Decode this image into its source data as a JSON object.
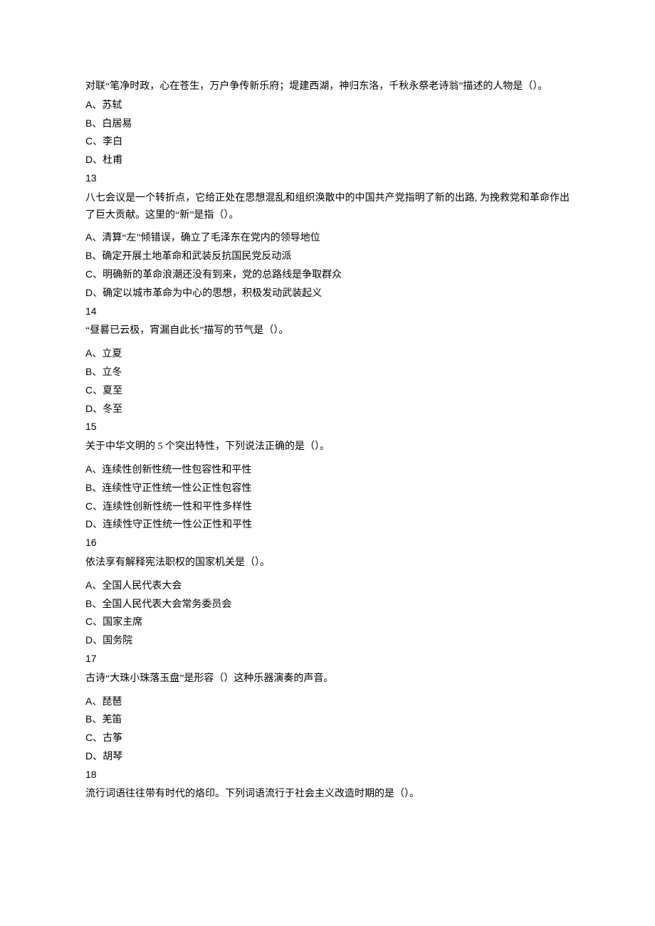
{
  "questions": [
    {
      "text": "对联“笔净时政，心在苍生，万户争传新乐府；堤建西湖，神归东洛，千秋永祭老诗翁”描述的人物是（）。",
      "options": [
        {
          "letter": "A",
          "text": "苏轼"
        },
        {
          "letter": "B",
          "text": "白居易"
        },
        {
          "letter": "C",
          "text": "李白"
        },
        {
          "letter": "D",
          "text": "杜甫"
        }
      ],
      "next_number": "13"
    },
    {
      "text": "八七会议是一个转折点，它给正处在思想混乱和组织涣散中的中国共产党指明了新的出路, 为挽救党和革命作出了巨大贡献。这里的“新”是指（）。",
      "options": [
        {
          "letter": "A",
          "text": "清算“左”倾错误，确立了毛泽东在党内的领导地位"
        },
        {
          "letter": "B",
          "text": "确定开展土地革命和武装反抗国民党反动派"
        },
        {
          "letter": "C",
          "text": "明确新的革命浪潮还没有到来，党的总路线是争取群众"
        },
        {
          "letter": "D",
          "text": "确定以城市革命为中心的思想，积极发动武装起义"
        }
      ],
      "next_number": "14"
    },
    {
      "text": "“昼晷已云极，宵漏自此长”描写的节气是（）。",
      "options": [
        {
          "letter": "A",
          "text": "立夏"
        },
        {
          "letter": "B",
          "text": "立冬"
        },
        {
          "letter": "C",
          "text": "夏至"
        },
        {
          "letter": "D",
          "text": "冬至"
        }
      ],
      "next_number": "15"
    },
    {
      "text": "关于中华文明的 5 个突出特性，下列说法正确的是（）。",
      "options": [
        {
          "letter": "A",
          "text": "连续性创新性统一性包容性和平性"
        },
        {
          "letter": "B",
          "text": "连续性守正性统一性公正性包容性"
        },
        {
          "letter": "C",
          "text": "连续性创新性统一性和平性多样性"
        },
        {
          "letter": "D",
          "text": "连续性守正性统一性公正性和平性"
        }
      ],
      "next_number": "16"
    },
    {
      "text": "依法享有解释宪法职权的国家机关是（）。",
      "options": [
        {
          "letter": "A",
          "text": "全国人民代表大会"
        },
        {
          "letter": "B",
          "text": "全国人民代表大会常务委员会"
        },
        {
          "letter": "C",
          "text": "国家主席"
        },
        {
          "letter": "D",
          "text": "国务院"
        }
      ],
      "next_number": "17"
    },
    {
      "text": "古诗“大珠小珠落玉盘”是形容（）这种乐器演奏的声音。",
      "options": [
        {
          "letter": "A",
          "text": "琵琶"
        },
        {
          "letter": "B",
          "text": "羌笛"
        },
        {
          "letter": "C",
          "text": "古筝"
        },
        {
          "letter": "D",
          "text": "胡琴"
        }
      ],
      "next_number": "18"
    },
    {
      "text": "流行词语往往带有时代的烙印。下列词语流行于社会主义改造时期的是（）。",
      "options": [],
      "next_number": null
    }
  ]
}
